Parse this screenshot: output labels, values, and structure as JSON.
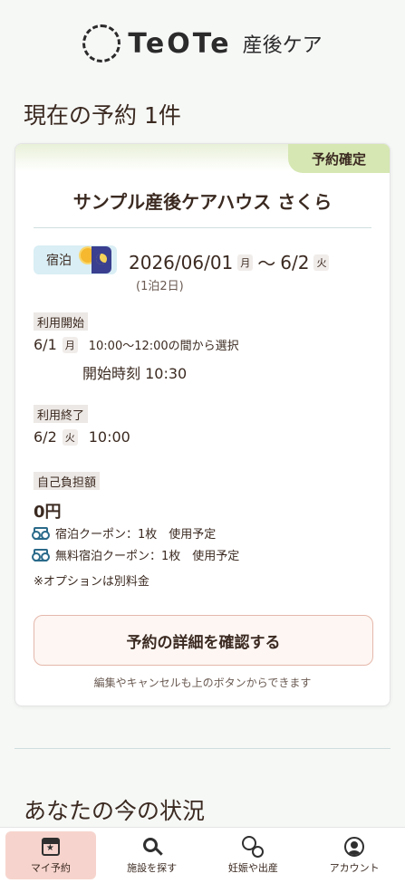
{
  "header": {
    "logo_text": "TeOTe",
    "logo_sub": "産後ケア"
  },
  "reservations": {
    "title": "現在の予約 1件",
    "card": {
      "status": "予約確定",
      "facility": "サンプル産後ケアハウス さくら",
      "stay_type": "宿泊",
      "date_start": "2026/06/01",
      "date_start_dow": "月",
      "date_sep": "〜",
      "date_end": "6/2",
      "date_end_dow": "火",
      "nights": "(1泊2日)",
      "start_label": "利用開始",
      "start_date": "6/1",
      "start_dow": "月",
      "start_window": "10:00〜12:00の間から選択",
      "start_time": "開始時刻 10:30",
      "end_label": "利用終了",
      "end_date": "6/2",
      "end_dow": "火",
      "end_time": "10:00",
      "cost_label": "自己負担額",
      "cost_amount": "0円",
      "coupons": [
        "宿泊クーポン：1枚　使用予定",
        "無料宿泊クーポン：1枚　使用予定"
      ],
      "option_note": "※オプションは別料金",
      "detail_button": "予約の詳細を確認する",
      "hint": "編集やキャンセルも上のボタンからできます"
    }
  },
  "status_section": {
    "title": "あなたの今の状況"
  },
  "nav": {
    "items": [
      {
        "label": "マイ予約",
        "icon": "calendar-star-icon",
        "active": true
      },
      {
        "label": "施設を探す",
        "icon": "search-icon",
        "active": false
      },
      {
        "label": "妊娠や出産",
        "icon": "mother-baby-icon",
        "active": false
      },
      {
        "label": "アカウント",
        "icon": "account-icon",
        "active": false
      }
    ]
  }
}
